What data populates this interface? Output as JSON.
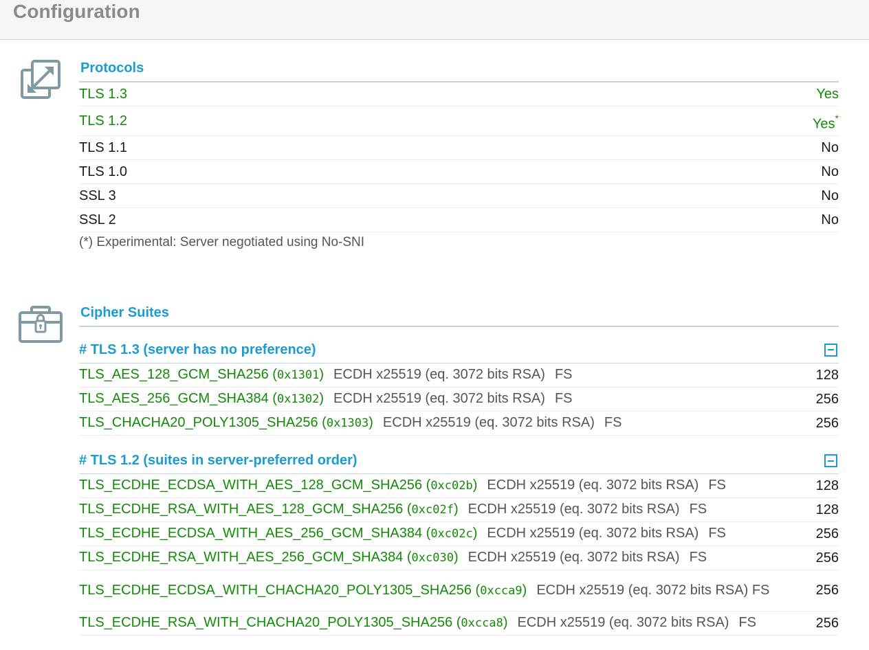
{
  "page": {
    "title": "Configuration"
  },
  "protocols": {
    "title": "Protocols",
    "rows": [
      {
        "name": "TLS 1.3",
        "value": "Yes",
        "supported": true,
        "note": ""
      },
      {
        "name": "TLS 1.2",
        "value": "Yes",
        "supported": true,
        "note": "*"
      },
      {
        "name": "TLS 1.1",
        "value": "No",
        "supported": false,
        "note": ""
      },
      {
        "name": "TLS 1.0",
        "value": "No",
        "supported": false,
        "note": ""
      },
      {
        "name": "SSL 3",
        "value": "No",
        "supported": false,
        "note": ""
      },
      {
        "name": "SSL 2",
        "value": "No",
        "supported": false,
        "note": ""
      }
    ],
    "footnote": "(*) Experimental: Server negotiated using No-SNI"
  },
  "cipher_suites": {
    "title": "Cipher Suites",
    "groups": [
      {
        "header": "# TLS 1.3 (server has no preference)",
        "suites": [
          {
            "name": "TLS_AES_128_GCM_SHA256",
            "code": "0x1301",
            "kx": "ECDH x25519 (eq. 3072 bits RSA)",
            "fs": "FS",
            "bits": "128"
          },
          {
            "name": "TLS_AES_256_GCM_SHA384",
            "code": "0x1302",
            "kx": "ECDH x25519 (eq. 3072 bits RSA)",
            "fs": "FS",
            "bits": "256"
          },
          {
            "name": "TLS_CHACHA20_POLY1305_SHA256",
            "code": "0x1303",
            "kx": "ECDH x25519 (eq. 3072 bits RSA)",
            "fs": "FS",
            "bits": "256"
          }
        ]
      },
      {
        "header": "# TLS 1.2 (suites in server-preferred order)",
        "suites": [
          {
            "name": "TLS_ECDHE_ECDSA_WITH_AES_128_GCM_SHA256",
            "code": "0xc02b",
            "kx": "ECDH x25519 (eq. 3072 bits RSA)",
            "fs": "FS",
            "bits": "128"
          },
          {
            "name": "TLS_ECDHE_RSA_WITH_AES_128_GCM_SHA256",
            "code": "0xc02f",
            "kx": "ECDH x25519 (eq. 3072 bits RSA)",
            "fs": "FS",
            "bits": "128"
          },
          {
            "name": "TLS_ECDHE_ECDSA_WITH_AES_256_GCM_SHA384",
            "code": "0xc02c",
            "kx": "ECDH x25519 (eq. 3072 bits RSA)",
            "fs": "FS",
            "bits": "256"
          },
          {
            "name": "TLS_ECDHE_RSA_WITH_AES_256_GCM_SHA384",
            "code": "0xc030",
            "kx": "ECDH x25519 (eq. 3072 bits RSA)",
            "fs": "FS",
            "bits": "256"
          },
          {
            "name": "TLS_ECDHE_ECDSA_WITH_CHACHA20_POLY1305_SHA256",
            "code": "0xcca9",
            "kx": "ECDH x25519 (eq. 3072 bits RSA)",
            "fs": "FS",
            "bits": "256"
          },
          {
            "name": "TLS_ECDHE_RSA_WITH_CHACHA20_POLY1305_SHA256",
            "code": "0xcca8",
            "kx": "ECDH x25519 (eq. 3072 bits RSA)",
            "fs": "FS",
            "bits": "256"
          }
        ]
      }
    ]
  },
  "colors": {
    "accent": "#1a9bd2",
    "supported": "#138a07",
    "muted": "#555555",
    "header_bg": "#f6f6f6",
    "icon": "#7f9aa3"
  },
  "icons": {
    "protocols": "arrows-expand-icon",
    "cipher_suites": "locked-case-icon",
    "collapse": "collapse-minus-icon"
  }
}
